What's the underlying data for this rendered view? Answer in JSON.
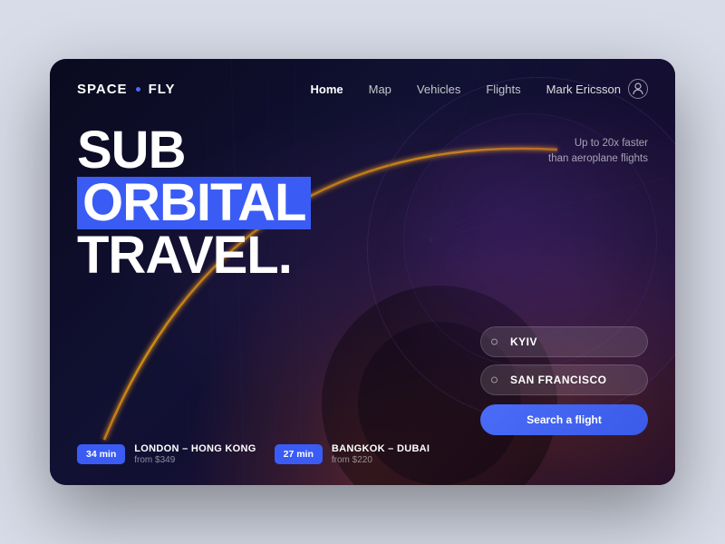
{
  "logo": {
    "brand1": "SPACE",
    "brand2": "FLY"
  },
  "nav": {
    "links": [
      {
        "label": "Home",
        "active": true
      },
      {
        "label": "Map",
        "active": false
      },
      {
        "label": "Vehicles",
        "active": false
      },
      {
        "label": "Flights",
        "active": false
      }
    ],
    "user": "Mark Ericsson"
  },
  "hero": {
    "line1": "SUB",
    "line2": "ORBITAL",
    "line3": "TRAVEL."
  },
  "tagline": {
    "line1": "Up to 20x faster",
    "line2": "than aeroplane flights"
  },
  "form": {
    "origin": "KYIV",
    "destination": "SAN FRANCISCO",
    "search_button": "Search a flight"
  },
  "flights": [
    {
      "time": "34 min",
      "route": "LONDON – HONG KONG",
      "price": "from $349"
    },
    {
      "time": "27 min",
      "route": "BANGKOK – DUBAI",
      "price": "from $220"
    }
  ]
}
